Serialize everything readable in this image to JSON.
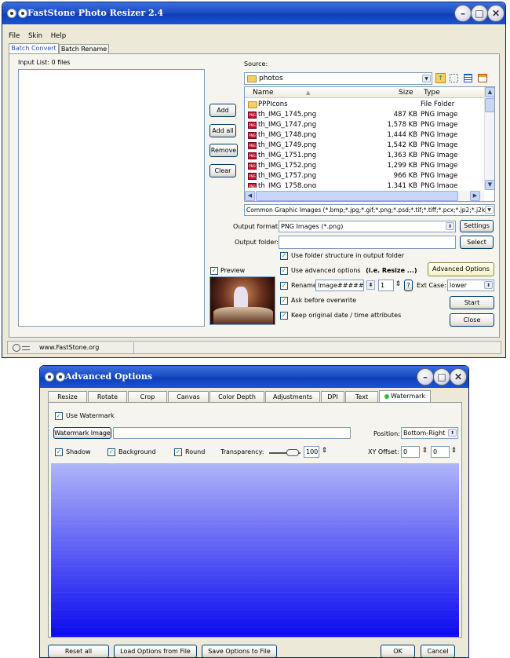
{
  "main_window": {
    "title": "FastStone Photo Resizer 2.4",
    "menu": [
      "File",
      "Skin",
      "Help"
    ],
    "tabs": [
      "Batch Convert",
      "Batch Rename"
    ],
    "input_list_label": "Input List:  0 files",
    "buttons": {
      "add": "Add",
      "add_all": "Add all",
      "remove": "Remove",
      "clear": "Clear"
    },
    "source_label": "Source:",
    "source_folder": "photos",
    "file_columns": {
      "name": "Name",
      "size": "Size",
      "type": "Type"
    },
    "files": [
      {
        "name": "PPPIcons",
        "size": "",
        "type": "File Folder"
      },
      {
        "name": "th_IMG_1745.png",
        "size": "487 KB",
        "type": "PNG Image"
      },
      {
        "name": "th_IMG_1747.png",
        "size": "1,578 KB",
        "type": "PNG Image"
      },
      {
        "name": "th_IMG_1748.png",
        "size": "1,444 KB",
        "type": "PNG Image"
      },
      {
        "name": "th_IMG_1749.png",
        "size": "1,542 KB",
        "type": "PNG Image"
      },
      {
        "name": "th_IMG_1751.png",
        "size": "1,363 KB",
        "type": "PNG Image"
      },
      {
        "name": "th_IMG_1752.png",
        "size": "1,299 KB",
        "type": "PNG Image"
      },
      {
        "name": "th_IMG_1757.png",
        "size": "966 KB",
        "type": "PNG Image"
      },
      {
        "name": "th_IMG_1758.png",
        "size": "1,341 KB",
        "type": "PNG Image"
      }
    ],
    "filter": "Common Graphic Images (*.bmp;*.jpg;*.gif;*.png;*.psd;*.tif;*.tiff;*.pcx;*.jp2;*.j2k;",
    "output_format_label": "Output format:",
    "output_format": "PNG Images (*.png)",
    "settings_label": "Settings",
    "output_folder_label": "Output folder:",
    "output_folder": "",
    "select_label": "Select",
    "preview_label": "Preview",
    "use_folder_structure": "Use folder structure in output folder",
    "use_advanced_options": "Use advanced options",
    "advanced_hint": "(i.e. Resize ...)",
    "advanced_options_button": "Advanced Options",
    "rename_label": "Rename",
    "rename_pattern": "Image#####",
    "rename_start": "1",
    "help_label": "?",
    "ext_case_label": "Ext Case:",
    "ext_case": "lower",
    "ask_overwrite": "Ask before overwrite",
    "keep_date": "Keep original date / time attributes",
    "start_label": "Start",
    "close_label": "Close",
    "status_url": "www.FastStone.org"
  },
  "adv_window": {
    "title": "Advanced Options",
    "tabs": [
      "Resize",
      "Rotate",
      "Crop",
      "Canvas",
      "Color Depth",
      "Adjustments",
      "DPI",
      "Text",
      "Watermark"
    ],
    "use_watermark": "Use Watermark",
    "watermark_image_button": "Watermark Image",
    "watermark_path": "",
    "position_label": "Position:",
    "position_value": "Bottom-Right",
    "shadow_label": "Shadow",
    "background_label": "Background",
    "round_label": "Round",
    "transparency_label": "Transparency:",
    "transparency_value": "100",
    "xy_offset_label": "XY Offset:",
    "x_offset": "0",
    "y_offset": "0",
    "reset_all": "Reset all",
    "load_options": "Load Options from File",
    "save_options": "Save Options to File",
    "ok_label": "OK",
    "cancel_label": "Cancel"
  },
  "colors": {
    "title_blue": "#1d4fc4",
    "window_bg": "#ece9d8",
    "gradient_top": "#b0b4f8",
    "gradient_bottom": "#0a0af0"
  }
}
